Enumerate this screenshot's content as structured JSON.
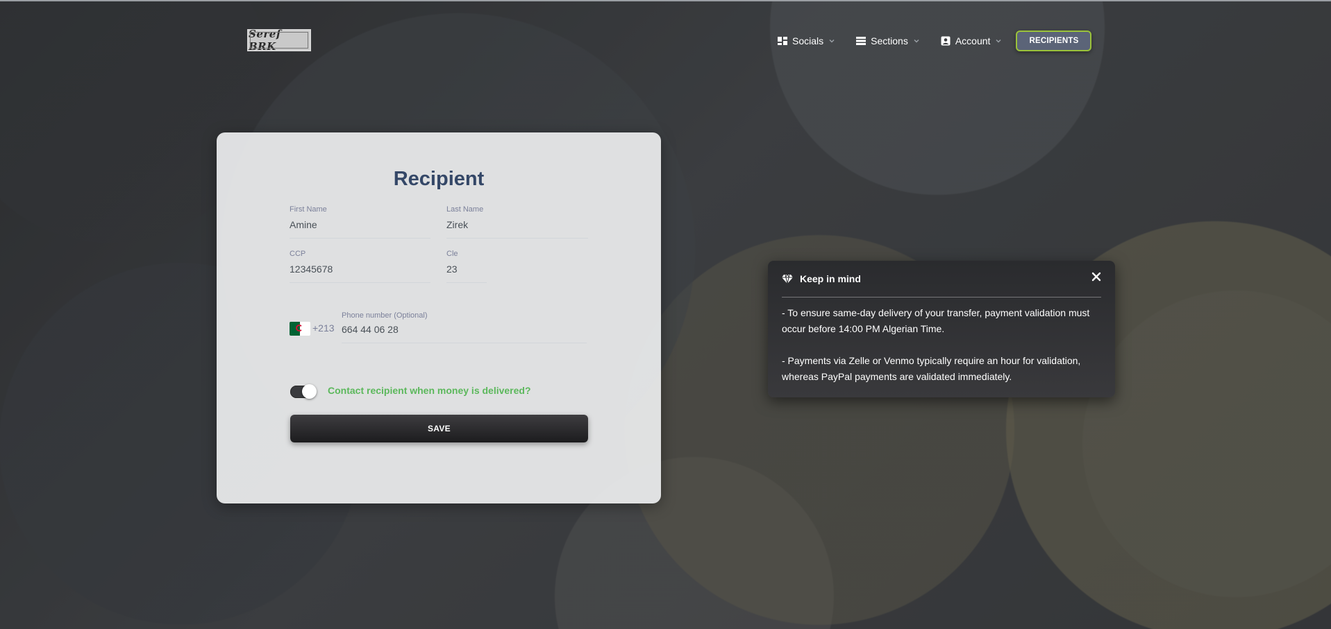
{
  "nav": {
    "logo_text": "Seref BRK",
    "items": [
      {
        "label": "Socials",
        "icon": "dashboard-icon"
      },
      {
        "label": "Sections",
        "icon": "view-list-icon"
      },
      {
        "label": "Account",
        "icon": "account-box-icon"
      }
    ],
    "active_button": "RECIPIENTS"
  },
  "form": {
    "title": "Recipient",
    "first_name": {
      "label": "First Name",
      "value": "Amine"
    },
    "last_name": {
      "label": "Last Name",
      "value": "Zirek"
    },
    "ccp": {
      "label": "CCP",
      "value": "12345678"
    },
    "cle": {
      "label": "Cle",
      "value": "23"
    },
    "phone": {
      "label": "Phone number (Optional)",
      "dial_code": "+213",
      "value": "664 44 06 28",
      "flag": "algeria-flag"
    },
    "contact_toggle": {
      "label": "Contact recipient when money is delivered?",
      "checked": true
    },
    "save_label": "SAVE"
  },
  "toast": {
    "title": "Keep in mind",
    "icon": "diamond-icon",
    "lines": [
      "- To ensure same-day delivery of your transfer, payment validation must occur before 14:00 PM Algerian Time.",
      "- Payments via Zelle or Venmo typically require an hour for validation, whereas PayPal payments are validated immediately."
    ]
  },
  "colors": {
    "title": "#344767",
    "accent_green": "#5cb85c",
    "nav_button": "#5b6478",
    "nav_button_border": "#9ac23a"
  }
}
